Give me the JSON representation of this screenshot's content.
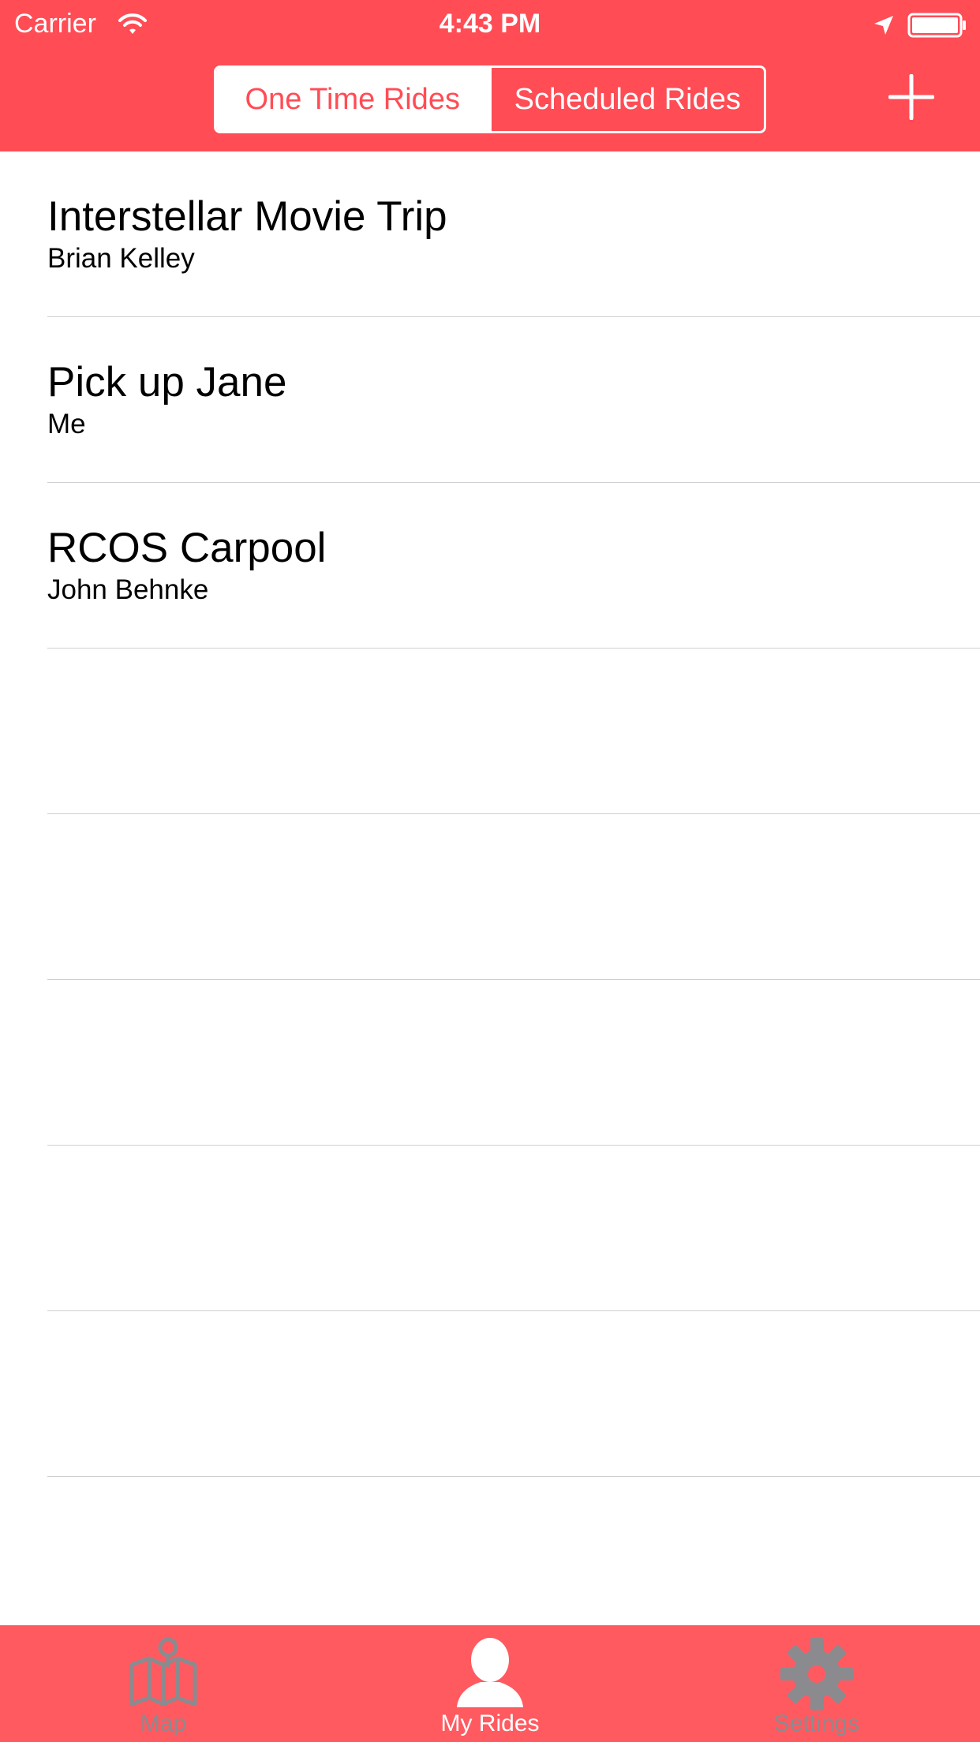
{
  "status_bar": {
    "carrier": "Carrier",
    "time": "4:43 PM",
    "icons": [
      "wifi-icon",
      "location-arrow-icon",
      "battery-icon"
    ]
  },
  "header": {
    "segments": [
      {
        "label": "One Time Rides",
        "selected": true
      },
      {
        "label": "Scheduled Rides",
        "selected": false
      }
    ],
    "add_icon": "plus-icon"
  },
  "rides": [
    {
      "title": "Interstellar Movie Trip",
      "owner": "Brian Kelley"
    },
    {
      "title": "Pick up Jane",
      "owner": "Me"
    },
    {
      "title": "RCOS Carpool",
      "owner": "John Behnke"
    }
  ],
  "tabbar": {
    "tabs": [
      {
        "label": "Map",
        "icon": "map-icon",
        "selected": false
      },
      {
        "label": "My Rides",
        "icon": "person-icon",
        "selected": true
      },
      {
        "label": "Settings",
        "icon": "gear-icon",
        "selected": false
      }
    ]
  },
  "colors": {
    "accent": "#ff4c55",
    "tabbar": "#ff5a60",
    "inactive_tab": "#8b8b8f",
    "separator": "#cfcfd3"
  }
}
